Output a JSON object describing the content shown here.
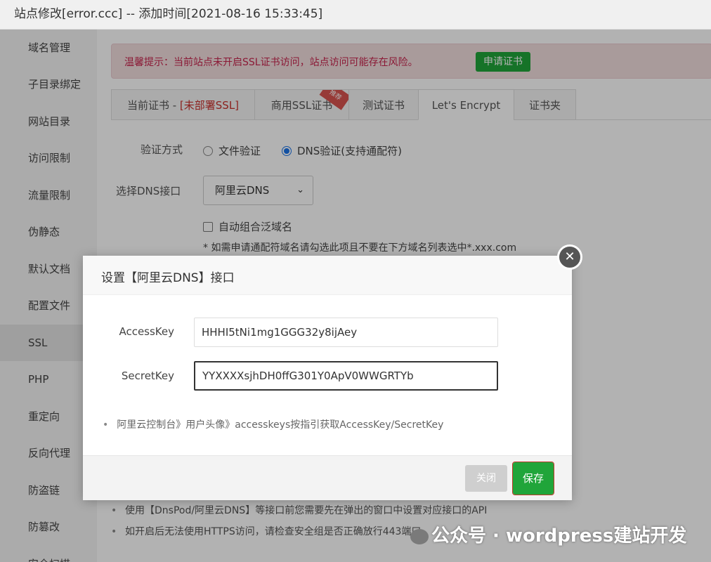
{
  "window": {
    "title": "站点修改[error.ccc] -- 添加时间[2021-08-16 15:33:45]"
  },
  "sidebar": {
    "items": [
      {
        "label": "域名管理"
      },
      {
        "label": "子目录绑定"
      },
      {
        "label": "网站目录"
      },
      {
        "label": "访问限制"
      },
      {
        "label": "流量限制"
      },
      {
        "label": "伪静态"
      },
      {
        "label": "默认文档"
      },
      {
        "label": "配置文件"
      },
      {
        "label": "SSL"
      },
      {
        "label": "PHP"
      },
      {
        "label": "重定向"
      },
      {
        "label": "反向代理"
      },
      {
        "label": "防盗链"
      },
      {
        "label": "防篡改"
      },
      {
        "label": "安全扫描"
      }
    ],
    "active": "SSL"
  },
  "alert": {
    "message": "温馨提示：当前站点未开启SSL证书访问，站点访问可能存在风险。",
    "button_label": "申请证书"
  },
  "tabs": {
    "current_cert_prefix": "当前证书 - ",
    "current_cert_status": "[未部署SSL]",
    "commercial": "商用SSL证书",
    "commercial_badge": "推荐",
    "test": "测试证书",
    "letsencrypt": "Let's Encrypt",
    "folder": "证书夹",
    "active": "Let's Encrypt"
  },
  "verify": {
    "label": "验证方式",
    "option_file": "文件验证",
    "option_dns": "DNS验证(支持通配符)",
    "selected": "DNS验证(支持通配符)"
  },
  "dns": {
    "label": "选择DNS接口",
    "selected": "阿里云DNS"
  },
  "wildcard": {
    "checkbox_label": "自动组合泛域名",
    "note": "* 如需申请通配符域名请勾选此项且不要在下方域名列表选中*.xxx.com"
  },
  "bullets": [
    "使用【DnsPod/阿里云DNS】等接口前您需要先在弹出的窗口中设置对应接口的API",
    "如开启后无法使用HTTPS访问，请检查安全组是否正确放行443端口"
  ],
  "modal": {
    "title": "设置【阿里云DNS】接口",
    "access_key_label": "AccessKey",
    "access_key_value": "HHHI5tNi1mg1GGG32y8ijAey",
    "secret_key_label": "SecretKey",
    "secret_key_value": "YYXXXXsjhDH0ffG301Y0ApV0WWGRTYb",
    "tip": "阿里云控制台》用户头像》accesskeys按指引获取AccessKey/SecretKey",
    "close_label": "关闭",
    "save_label": "保存"
  },
  "watermark": {
    "text": "公众号 · wordpress建站开发"
  },
  "colors": {
    "accent": "#20a53a",
    "alert_text": "#c7254e",
    "alert_bg": "#f2dede"
  }
}
